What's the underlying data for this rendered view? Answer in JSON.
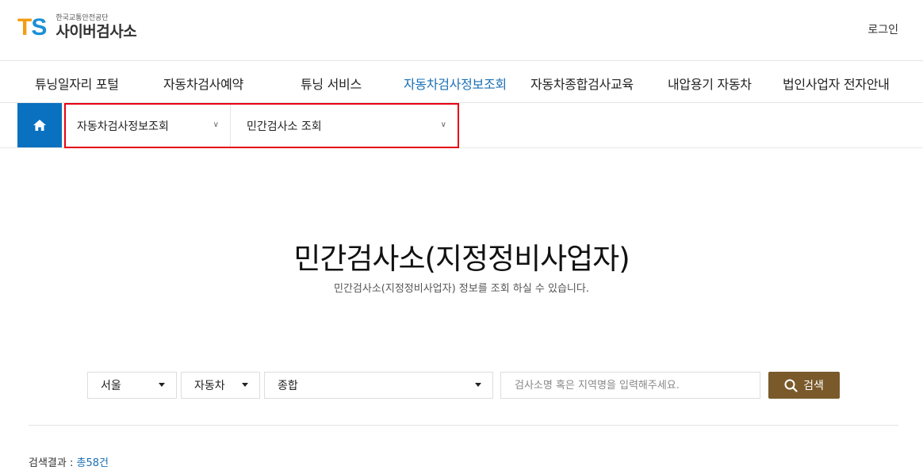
{
  "header": {
    "logo_mark_t": "T",
    "logo_mark_s": "S",
    "logo_org": "한국교통안전공단",
    "logo_site": "사이버검사소",
    "login_label": "로그인"
  },
  "gnb": {
    "items": [
      {
        "label": "튜닝일자리 포털"
      },
      {
        "label": "자동차검사예약"
      },
      {
        "label": "튜닝 서비스"
      },
      {
        "label": "자동차검사정보조회"
      },
      {
        "label": "자동차종합검사교육"
      },
      {
        "label": "내압용기 자동차"
      },
      {
        "label": "법인사업자 전자안내"
      }
    ],
    "active_index": 3
  },
  "location": {
    "home_icon": "home-icon",
    "depth1": "자동차검사정보조회",
    "depth2": "민간검사소 조회"
  },
  "page": {
    "title": "민간검사소(지정정비사업자)",
    "subtitle": "민간검사소(지정정비사업자) 정보를 조회 하실 수 있습니다."
  },
  "search": {
    "region_value": "서울",
    "type_value": "자동차",
    "category_value": "종합",
    "keyword_placeholder": "검사소명 혹은 지역명을 입력해주세요.",
    "keyword_value": "",
    "button_label": "검색",
    "button_color": "#7a5a2b"
  },
  "result": {
    "label": "검색결과 : ",
    "count": "총58건"
  },
  "colors": {
    "accent_blue": "#1a6fb5",
    "home_bg": "#0a70c0",
    "highlight_border": "#e60012"
  }
}
